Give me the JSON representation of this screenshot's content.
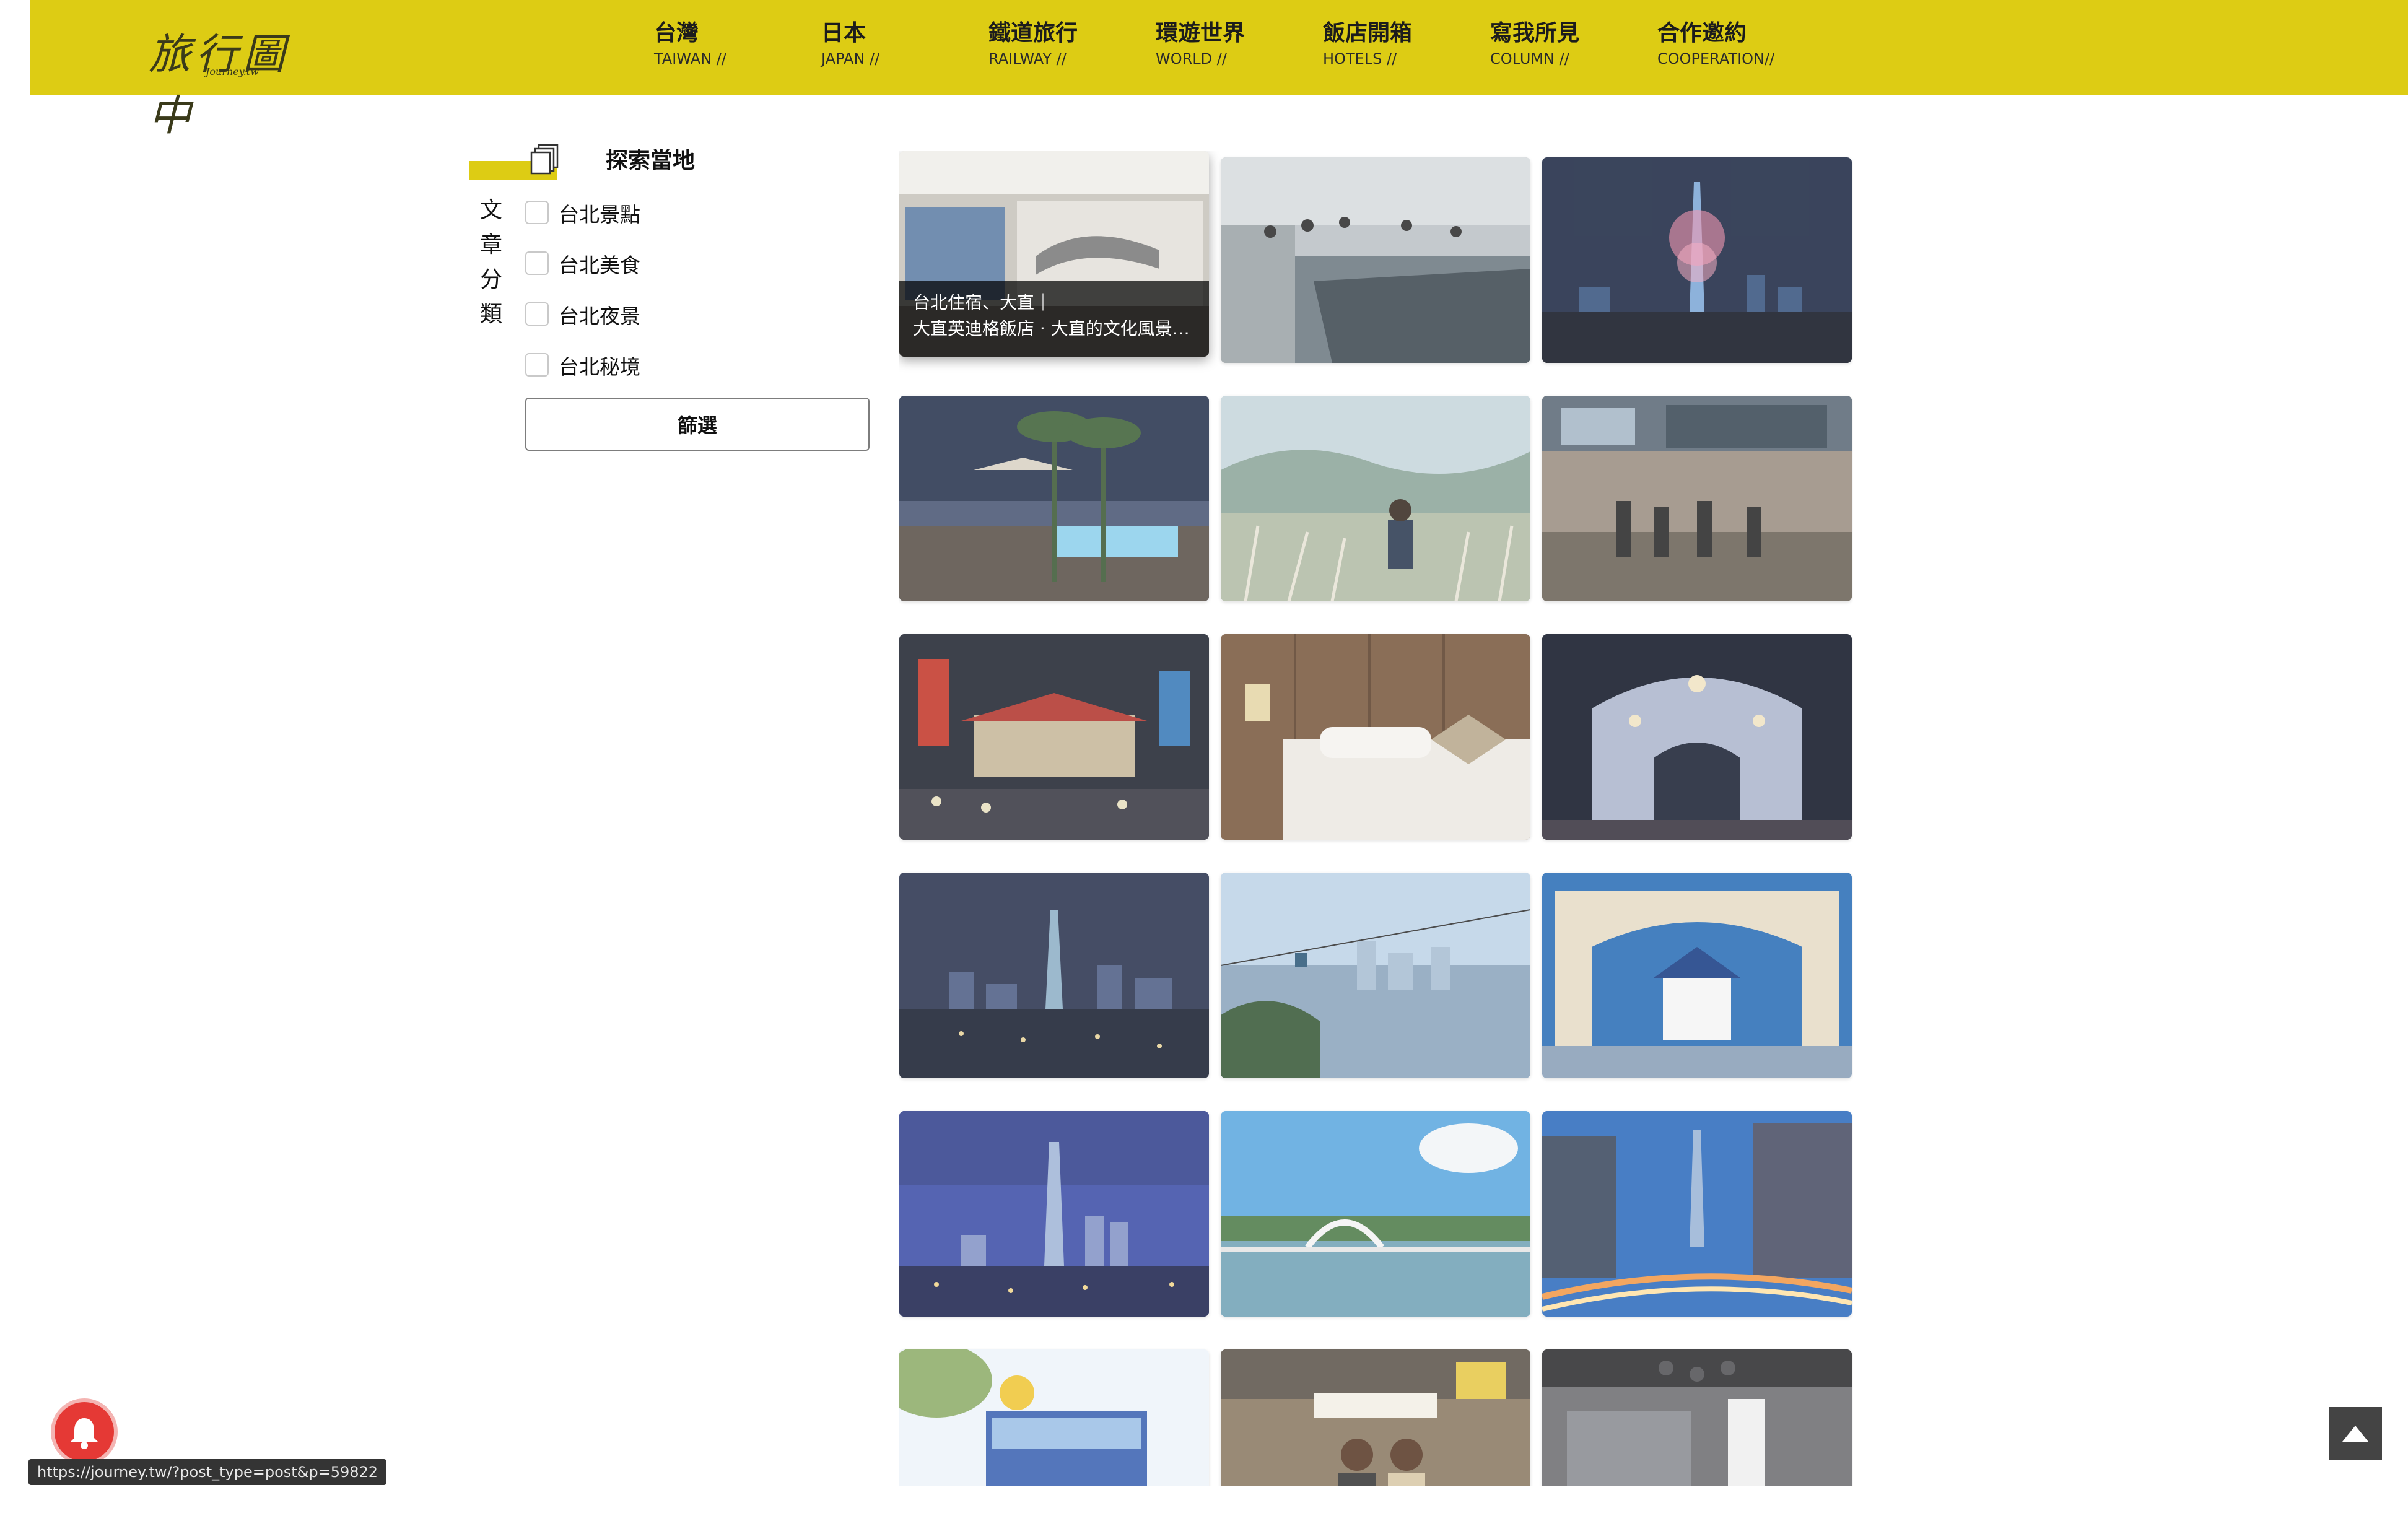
{
  "colors": {
    "brand_yellow": "#ddcc14",
    "caption_overlay": "#000000",
    "notify_red": "#e53935"
  },
  "header": {
    "logo": {
      "main": "旅行圖中",
      "sub": "Journey.tw"
    },
    "nav": [
      {
        "cn": "台灣",
        "en": "TAIWAN //"
      },
      {
        "cn": "日本",
        "en": "JAPAN //"
      },
      {
        "cn": "鐵道旅行",
        "en": "RAILWAY //"
      },
      {
        "cn": "環遊世界",
        "en": "WORLD //"
      },
      {
        "cn": "飯店開箱",
        "en": "HOTELS //"
      },
      {
        "cn": "寫我所見",
        "en": "COLUMN //"
      },
      {
        "cn": "合作邀約",
        "en": "COOPERATION//"
      }
    ]
  },
  "sidebar": {
    "title": "探索當地",
    "icon": "stacked-pages-icon",
    "category_label": [
      "文",
      "章",
      "分",
      "類"
    ],
    "options": [
      "台北景點",
      "台北美食",
      "台北夜景",
      "台北秘境"
    ],
    "filter_button": "篩選"
  },
  "grid": {
    "hovered_card_caption": [
      "台北住宿、大直｜",
      "大直英迪格飯店 · 大直的文化風景…"
    ],
    "cards": [
      {
        "scene": "hotel-lobby-icon"
      },
      {
        "scene": "fishing-pool-icon"
      },
      {
        "scene": "taipei101-night-icon"
      },
      {
        "scene": "rooftop-terrace-icon"
      },
      {
        "scene": "silvergrass-field-icon"
      },
      {
        "scene": "shopping-street-icon"
      },
      {
        "scene": "night-market-gate-icon"
      },
      {
        "scene": "hotel-bed-icon"
      },
      {
        "scene": "light-festival-icon"
      },
      {
        "scene": "city-night-skyline-icon"
      },
      {
        "scene": "gondola-city-view-icon"
      },
      {
        "scene": "memorial-hall-arch-icon"
      },
      {
        "scene": "taipei101-dusk-icon"
      },
      {
        "scene": "moon-bridge-lake-icon"
      },
      {
        "scene": "light-trails-street-icon"
      },
      {
        "scene": "tour-bus-icon"
      },
      {
        "scene": "market-friends-icon"
      },
      {
        "scene": "modern-interior-icon"
      }
    ]
  },
  "status_bar": {
    "url": "https://journey.tw/?post_type=post&p=59822"
  },
  "widgets": {
    "notification": "notification-bell-icon",
    "back_to_top": "back-to-top-icon"
  }
}
